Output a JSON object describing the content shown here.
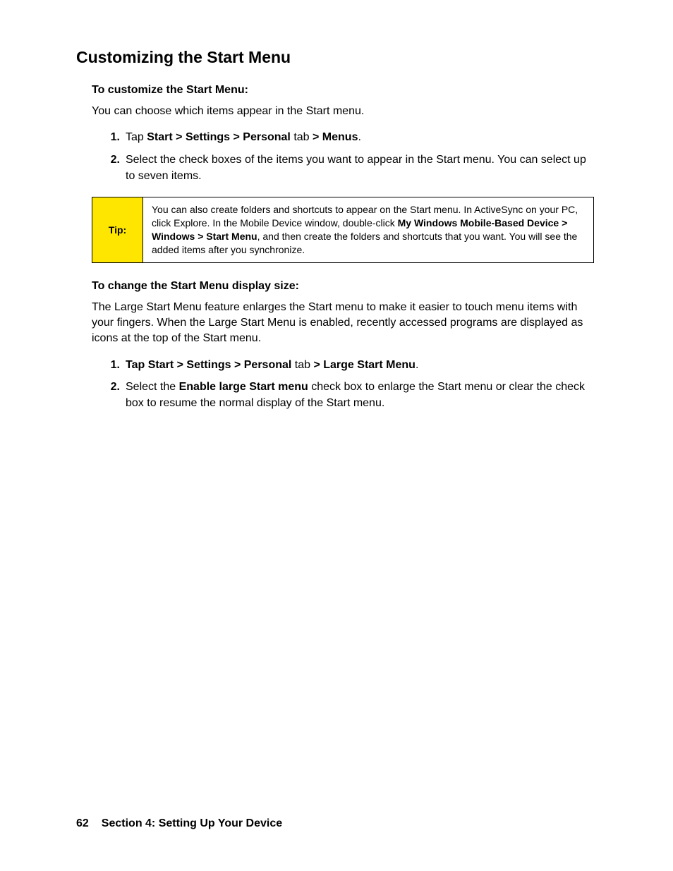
{
  "heading": "Customizing the Start Menu",
  "section1": {
    "subheading": "To customize the Start Menu:",
    "intro": "You can choose which items appear in the Start menu.",
    "step1": {
      "num": "1.",
      "t1": "Tap ",
      "b1": "Start > Settings > Personal",
      "t2": " tab ",
      "b2": "> Menus",
      "t3": "."
    },
    "step2": {
      "num": "2.",
      "text": "Select the check boxes of the items you want to appear in the Start menu. You can select up to seven items."
    }
  },
  "tip": {
    "label": "Tip:",
    "t1": "You can also create folders and shortcuts to appear on the Start menu. In ActiveSync on your PC, click Explore. In the Mobile Device window, double-click ",
    "b1": "My Windows Mobile-Based Device > Windows > Start Menu",
    "t2": ", and then create the folders and shortcuts that you want. You will see the added items after you synchronize."
  },
  "section2": {
    "subheading": "To change the Start Menu display size:",
    "intro": "The Large Start Menu feature enlarges the Start menu to make it easier to touch menu items with your fingers. When the Large Start Menu is enabled, recently accessed programs are displayed as icons at the top of the Start menu.",
    "step1": {
      "num": "1.",
      "b1": "Tap Start > Settings > Personal",
      "t1": " tab ",
      "b2": "> Large Start Menu",
      "t2": "."
    },
    "step2": {
      "num": "2.",
      "t1": "Select the ",
      "b1": "Enable large Start menu",
      "t2": " check box to enlarge the Start menu or clear the check box to resume the normal display of the Start menu."
    }
  },
  "footer": {
    "page": "62",
    "section": "Section 4: Setting Up Your Device"
  }
}
